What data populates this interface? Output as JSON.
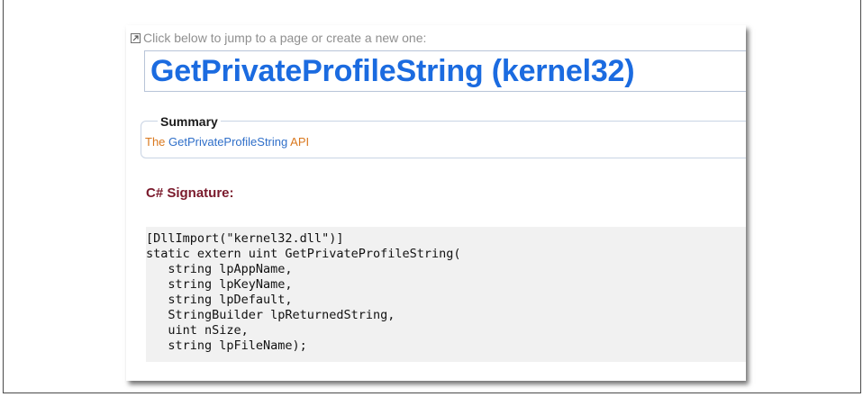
{
  "jump_hint": {
    "text": "Click below to jump to a page or create a new one:",
    "icon": "external-link-icon"
  },
  "page": {
    "title": "GetPrivateProfileString (kernel32)"
  },
  "summary": {
    "heading": "Summary",
    "prefix": "The ",
    "link": "GetPrivateProfileString",
    "suffix": " API"
  },
  "signature": {
    "heading": "C# Signature:",
    "code_lines": [
      "[DllImport(\"kernel32.dll\")]",
      "static extern uint GetPrivateProfileString(",
      "   string lpAppName,",
      "   string lpKeyName,",
      "   string lpDefault,",
      "   StringBuilder lpReturnedString,",
      "   uint nSize,",
      "   string lpFileName);"
    ]
  },
  "colors": {
    "title": "#1b6be0",
    "summary_text": "#d9781e",
    "summary_link": "#2f6fc9",
    "section_heading": "#7a1a2c",
    "code_background": "#f1f1f1"
  }
}
